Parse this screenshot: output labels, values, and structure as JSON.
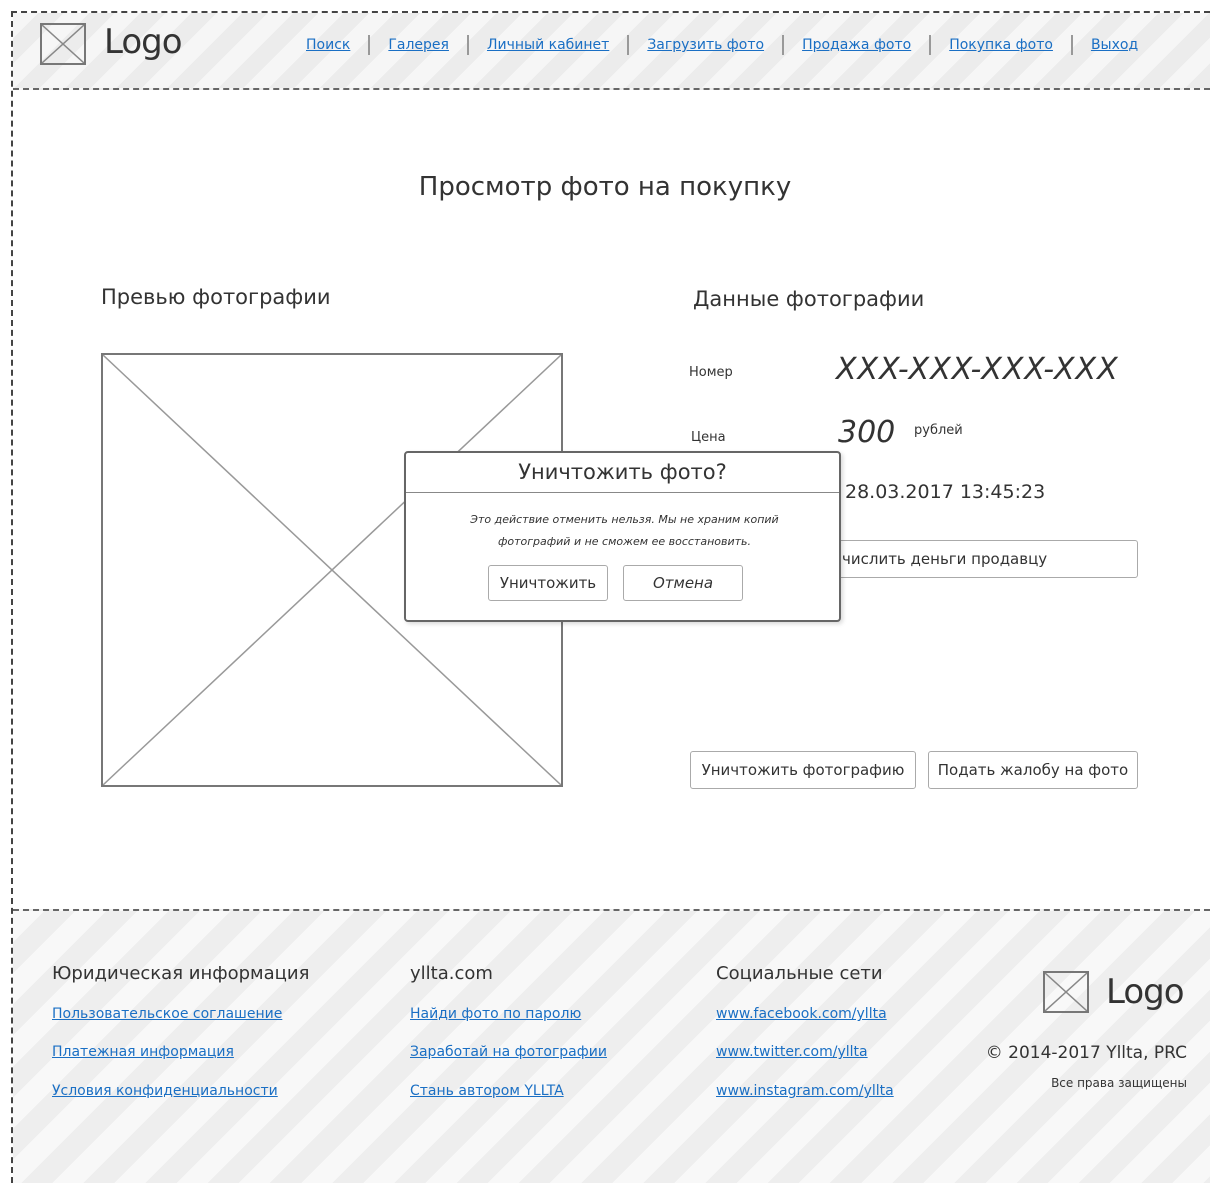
{
  "header": {
    "logo_text": "Logo",
    "nav": [
      "Поиск",
      "Галерея",
      "Личный кабинет",
      "Загрузить фото",
      "Продажа фото",
      "Покупка фото",
      "Выход"
    ]
  },
  "page": {
    "title": "Просмотр фото на покупку"
  },
  "preview": {
    "heading": "Превью фотографии"
  },
  "photo_data": {
    "heading": "Данные фотографии",
    "number_label": "Номер",
    "number_value": "XXX-XXX-XXX-XXX",
    "price_label": "Цена",
    "price_value": "300",
    "price_unit": "рублей",
    "date_value": "28.03.2017 13:45:23",
    "pay_button": "числить деньги продавцу",
    "destroy_button": "Уничтожить фотографию",
    "complaint_button": "Подать жалобу на фото"
  },
  "modal": {
    "title": "Уничтожить фото?",
    "text_line1": "Это действие отменить нельзя. Мы не храним копий",
    "text_line2": "фотографий и не сможем ее восстановить.",
    "confirm_button": "Уничтожить",
    "cancel_button": "Отмена"
  },
  "footer": {
    "col1": {
      "heading": "Юридическая информация",
      "links": [
        "Пользовательское соглашение",
        "Платежная информация",
        "Условия конфиденциальности"
      ]
    },
    "col2": {
      "heading": "yllta.com",
      "links": [
        "Найди фото по паролю",
        "Заработай на фотографии",
        "Стань автором YLLTA"
      ]
    },
    "col3": {
      "heading": "Социальные сети",
      "links": [
        "www.facebook.com/yllta",
        "www.twitter.com/yllta",
        "www.instagram.com/yllta"
      ]
    },
    "logo_text": "Logo",
    "copyright": "© 2014-2017 Yllta, PRC",
    "rights": "Все права защищены"
  },
  "colors": {
    "link": "#1a6fc4",
    "text": "#333333",
    "stripe_light": "#f6f6f6",
    "stripe_dark": "#ececec"
  },
  "icons": [
    "image-placeholder-icon"
  ]
}
